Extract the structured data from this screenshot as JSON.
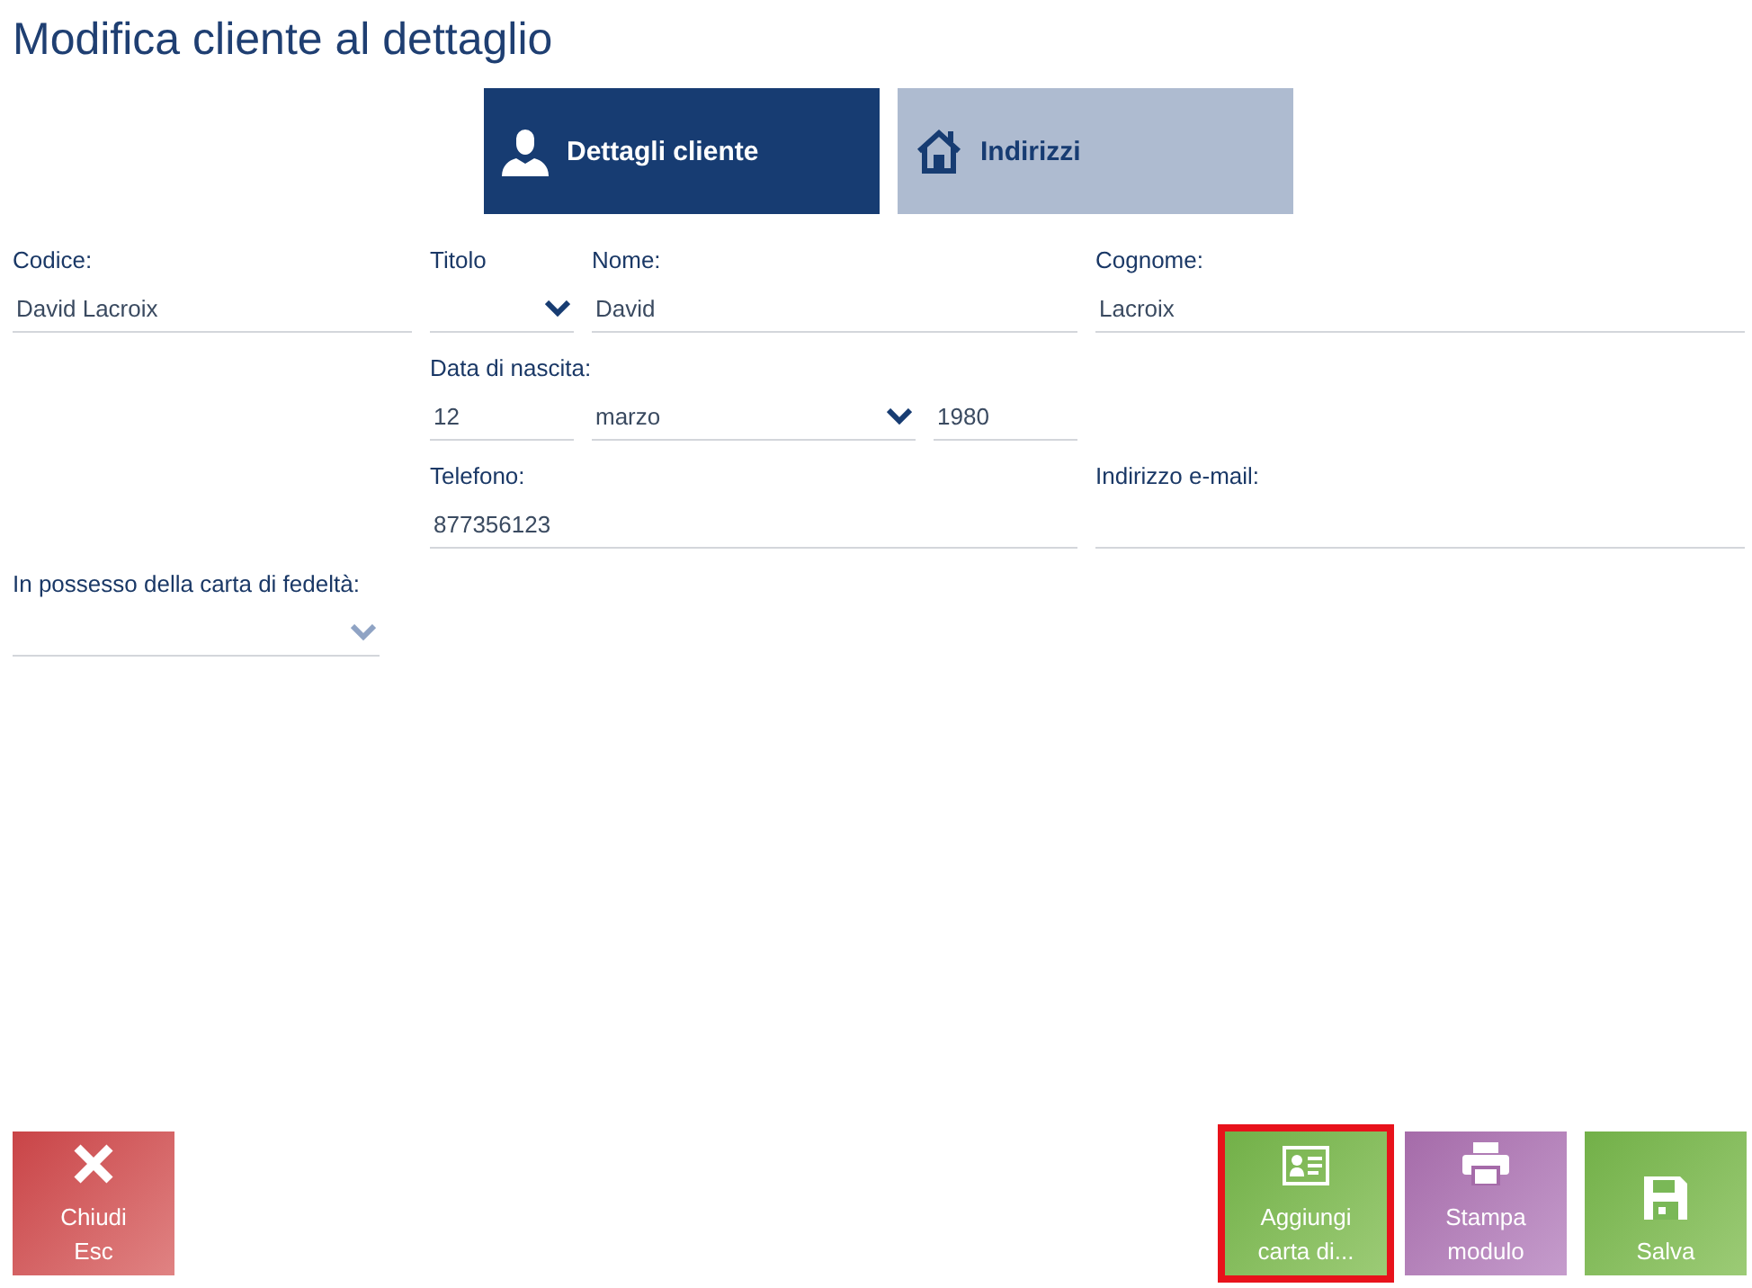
{
  "title": "Modifica cliente al dettaglio",
  "tabs": [
    {
      "label": "Dettagli cliente",
      "kind": "person",
      "selected": true
    },
    {
      "label": "Indirizzi",
      "kind": "house",
      "selected": false
    }
  ],
  "form": {
    "codice": {
      "label": "Codice:",
      "value": "David Lacroix"
    },
    "titolo": {
      "label": "Titolo",
      "disabled": false
    },
    "nome": {
      "label": "Nome:",
      "value": "David"
    },
    "cognome": {
      "label": "Cognome:",
      "value": "Lacroix"
    },
    "data_di_nascita": {
      "label": "Data di nascita:",
      "day": "12",
      "month": "marzo",
      "year": "1980"
    },
    "telefono": {
      "label": "Telefono:",
      "value": "877356123"
    },
    "email": {
      "label": "Indirizzo e-mail:"
    },
    "carta_fedelta": {
      "label": "In possesso della carta di fedeltà:",
      "disabled": true
    }
  },
  "buttons": [
    {
      "kind": "close",
      "label": "Chiudi",
      "shortcut": "Esc",
      "highlighted": false
    },
    {
      "kind": "card",
      "label": "Aggiungi carta di...",
      "highlighted": true
    },
    {
      "kind": "print",
      "label": "Stampa modulo",
      "highlighted": false
    },
    {
      "kind": "save",
      "label": "Salva",
      "highlighted": false
    }
  ]
}
